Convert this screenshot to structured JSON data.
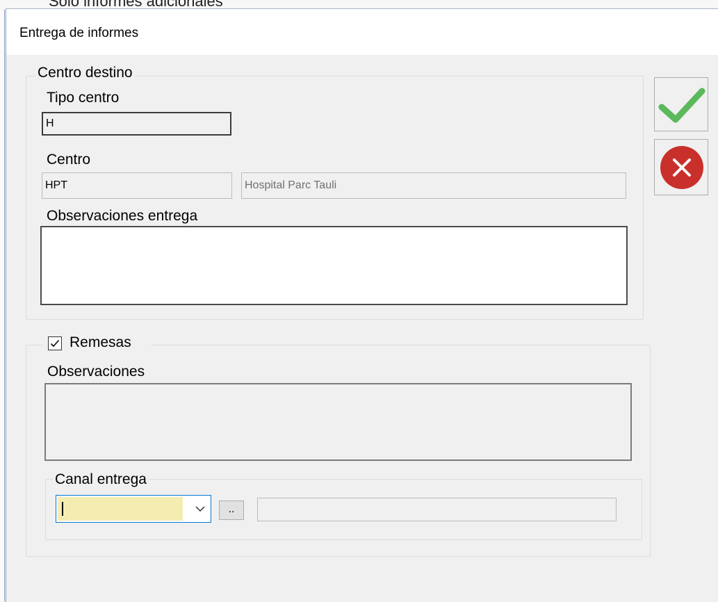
{
  "background": {
    "window_text": "Solo informes adicionales"
  },
  "dialog": {
    "title": "Entrega de informes",
    "centro_destino": {
      "legend": "Centro destino",
      "tipo_centro_label": "Tipo centro",
      "tipo_centro_value": "H",
      "centro_label": "Centro",
      "centro_code": "HPT",
      "centro_name": "Hospital Parc Tauli",
      "observaciones_entrega_label": "Observaciones entrega",
      "observaciones_entrega_value": ""
    },
    "remesas": {
      "checkbox_label": "Remesas",
      "checked": true,
      "observaciones_label": "Observaciones",
      "observaciones_value": "",
      "canal_entrega": {
        "legend": "Canal entrega",
        "selected_value": "",
        "browse_label": "..",
        "description_value": ""
      }
    },
    "buttons": {
      "accept_icon": "green-checkmark-icon",
      "cancel_icon": "red-circle-x-icon"
    },
    "colors": {
      "accept_green": "#5cb85c",
      "cancel_red": "#c9302c",
      "required_yellow": "#f5ecb1",
      "focus_blue": "#0078d7"
    }
  }
}
